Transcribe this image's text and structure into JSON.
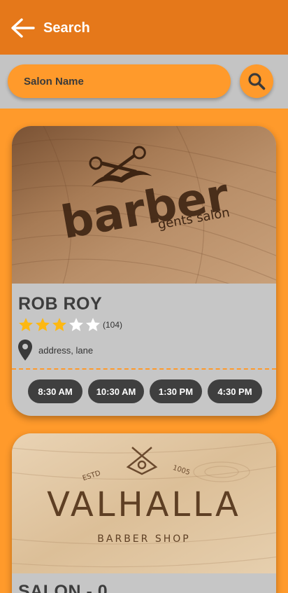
{
  "appbar": {
    "title": "Search"
  },
  "search": {
    "placeholder": "Salon Name"
  },
  "salons": [
    {
      "name": "ROB ROY",
      "logo_text": "barber",
      "logo_subtext": "gents salon",
      "rating": 3,
      "max_rating": 5,
      "review_count": "(104)",
      "address": "address, lane",
      "time_slots": [
        "8:30 AM",
        "10:30 AM",
        "1:30 PM",
        "4:30 PM"
      ]
    },
    {
      "name": "SALON - 0",
      "logo_text": "VALHALLA",
      "logo_subtext": "BARBER SHOP",
      "logo_estd_left": "ESTD",
      "logo_estd_right": "1005"
    }
  ],
  "colors": {
    "appbar": "#e5781a",
    "accent": "#ff9a2b",
    "card": "#c6c6c6",
    "slot": "#3f3f3f",
    "star_filled": "#fdb813",
    "star_empty": "#ffffff"
  },
  "icons": {
    "back": "arrow-left-icon",
    "search": "magnifier-icon",
    "location": "map-pin-icon",
    "star": "star-icon"
  }
}
